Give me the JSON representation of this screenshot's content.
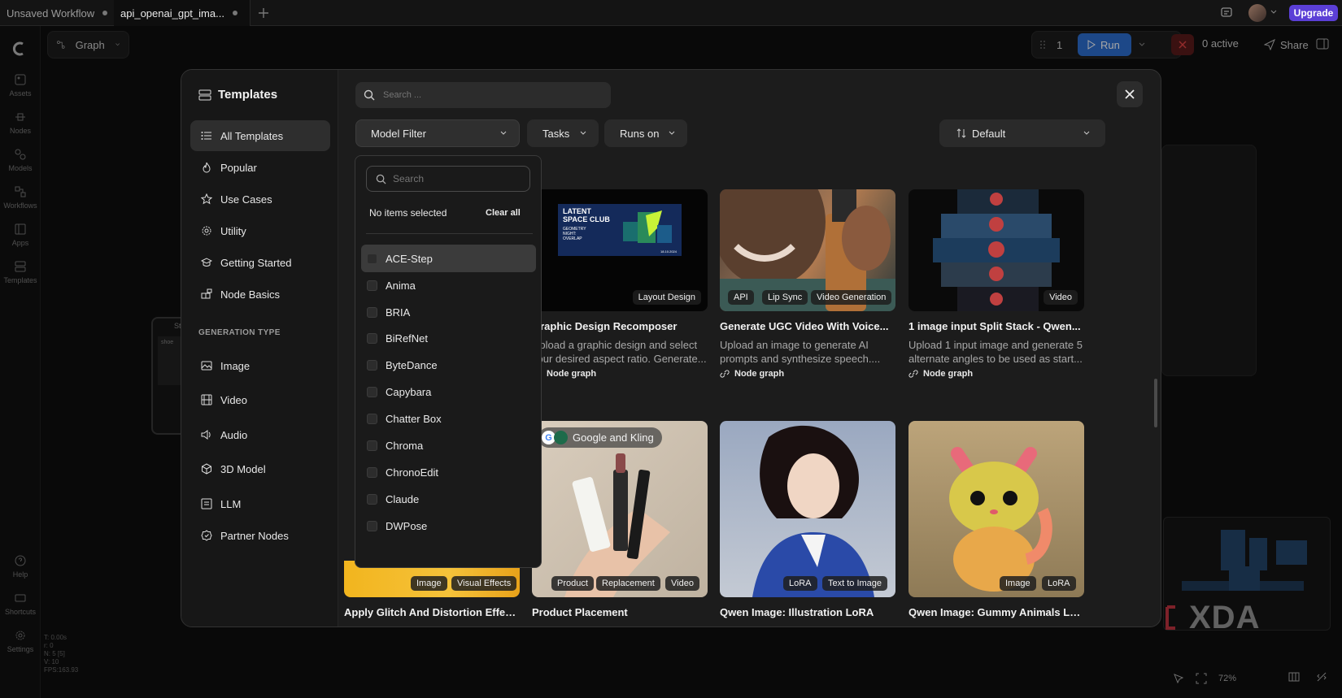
{
  "tabs": [
    {
      "label": "Unsaved Workflow"
    },
    {
      "label": "api_openai_gpt_ima..."
    }
  ],
  "header": {
    "upgrade": "Upgrade",
    "graph": "Graph",
    "queue_count": "1",
    "run": "Run",
    "active": "0 active",
    "share": "Share"
  },
  "rail": [
    "Assets",
    "Nodes",
    "Models",
    "Workflows",
    "Apps",
    "Templates",
    "Help",
    "Shortcuts",
    "Settings"
  ],
  "stats": [
    "T: 0.00s",
    "r: 0",
    "N: 5 [5]",
    "V: 10",
    "FPS:163.93"
  ],
  "canvas_node": {
    "label": "St",
    "text": "shoe"
  },
  "zoom": "72%",
  "watermark": "XDA",
  "modal": {
    "title": "Templates",
    "search_placeholder": "Search ...",
    "nav": [
      {
        "label": "All Templates",
        "icon": "list-icon"
      },
      {
        "label": "Popular",
        "icon": "flame-icon"
      },
      {
        "label": "Use Cases",
        "icon": "star-icon"
      },
      {
        "label": "Utility",
        "icon": "gear-icon"
      },
      {
        "label": "Getting Started",
        "icon": "graduation-cap-icon"
      },
      {
        "label": "Node Basics",
        "icon": "blocks-icon"
      }
    ],
    "generation_type_heading": "GENERATION TYPE",
    "generation_types": [
      {
        "label": "Image",
        "icon": "image-icon"
      },
      {
        "label": "Video",
        "icon": "film-icon"
      },
      {
        "label": "Audio",
        "icon": "speaker-icon"
      },
      {
        "label": "3D Model",
        "icon": "cube-icon"
      },
      {
        "label": "LLM",
        "icon": "text-doc-icon"
      },
      {
        "label": "Partner Nodes",
        "icon": "badge-icon"
      }
    ],
    "filters": {
      "model": "Model Filter",
      "tasks": "Tasks",
      "runs_on": "Runs on",
      "sort": "Default"
    },
    "dropdown": {
      "search_placeholder": "Search",
      "status": "No items selected",
      "clear": "Clear all",
      "options": [
        "ACE-Step",
        "Anima",
        "BRIA",
        "BiRefNet",
        "ByteDance",
        "Capybara",
        "Chatter Box",
        "Chroma",
        "ChronoEdit",
        "Claude",
        "DWPose"
      ]
    },
    "cards": [
      {
        "title": "Graphic Design Recomposer",
        "desc": "Upload a graphic design and select your desired aspect ratio. Generate...",
        "meta": "Node graph",
        "tags": [
          "Layout Design"
        ],
        "poster": {
          "line1": "LATENT",
          "line2": "SPACE CLUB",
          "line3": "GEOMETRY",
          "line4": "NIGHT:",
          "line5": "OVERLAP",
          "date": "18.10.2024"
        }
      },
      {
        "title": "Generate UGC Video With Voice...",
        "desc": "Upload an image to generate AI prompts and synthesize speech....",
        "meta": "Node graph",
        "tags": [
          "API",
          "Lip Sync",
          "Video Generation"
        ]
      },
      {
        "title": "1 image input Split Stack - Qwen...",
        "desc": "Upload 1 input image and generate 5 alternate angles to be used as start...",
        "meta": "Node graph",
        "tags": [
          "Video"
        ]
      },
      {
        "title": "Apply Glitch And Distortion Effects",
        "tags": [
          "Image",
          "Visual Effects"
        ]
      },
      {
        "title": "Product Placement",
        "tags": [
          "Product",
          "Replacement",
          "Video"
        ],
        "badge": "Google and Kling"
      },
      {
        "title": "Qwen Image: Illustration LoRA",
        "tags": [
          "LoRA",
          "Text to Image"
        ]
      },
      {
        "title": "Qwen Image: Gummy Animals LoRA",
        "tags": [
          "Image",
          "LoRA"
        ]
      }
    ]
  },
  "colors": {
    "accent": "#2d6fd1",
    "upgrade": "#5b3fd6",
    "danger": "#e04343",
    "xda_red": "#c0333f"
  }
}
